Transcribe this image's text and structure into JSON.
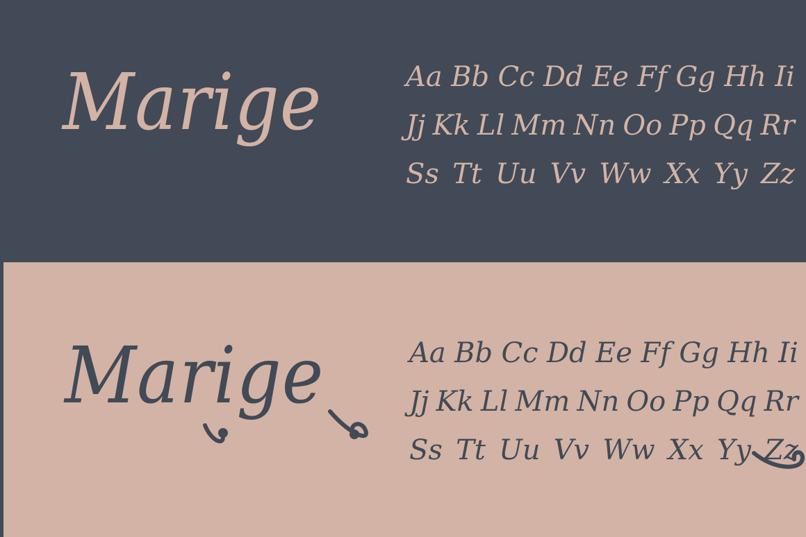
{
  "font_name": "Marige",
  "colors": {
    "dark": "#414a56",
    "blush": "#d3b3a5"
  },
  "alphabet_rows": [
    [
      "Aa",
      "Bb",
      "Cc",
      "Dd",
      "Ee",
      "Ff",
      "Gg",
      "Hh",
      "Ii"
    ],
    [
      "Jj",
      "Kk",
      "Ll",
      "Mm",
      "Nn",
      "Oo",
      "Pp",
      "Qq",
      "Rr"
    ],
    [
      "Ss",
      "Tt",
      "Uu",
      "Vv",
      "Ww",
      "Xx",
      "Yy",
      "Zz"
    ]
  ]
}
